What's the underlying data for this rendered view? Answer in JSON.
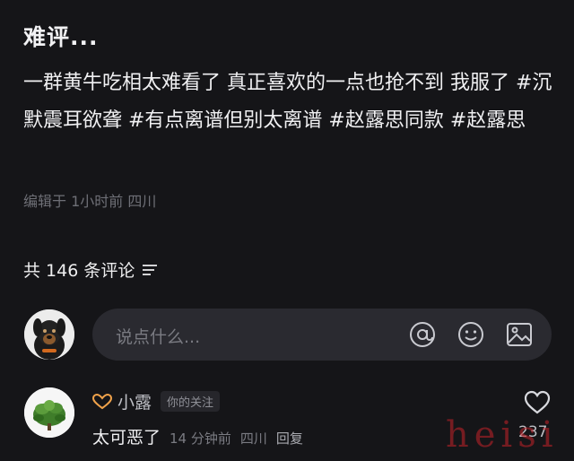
{
  "post": {
    "title": "难评...",
    "body": "一群黄牛吃相太难看了 真正喜欢的一点也抢不到 我服了 #沉默震耳欲聋 #有点离谱但别太离谱 #赵露思同款 #赵露思",
    "meta": "编辑于 1小时前 四川"
  },
  "comments_header": {
    "count_label": "共 146 条评论",
    "sort_icon": "sort-lines-icon"
  },
  "composer": {
    "placeholder": "说点什么...",
    "icons": [
      "at-icon",
      "emoji-icon",
      "image-icon"
    ]
  },
  "comment": {
    "name_icon": "heart-hands-icon",
    "name": "小露",
    "badge": "你的关注",
    "text": "太可恶了",
    "time": "14 分钟前",
    "location": "四川",
    "reply_label": "回复",
    "likes": "237"
  },
  "watermark": "heisi",
  "colors": {
    "background": "#151518",
    "input_bg": "#2a2a30",
    "watermark": "#c4222a"
  }
}
